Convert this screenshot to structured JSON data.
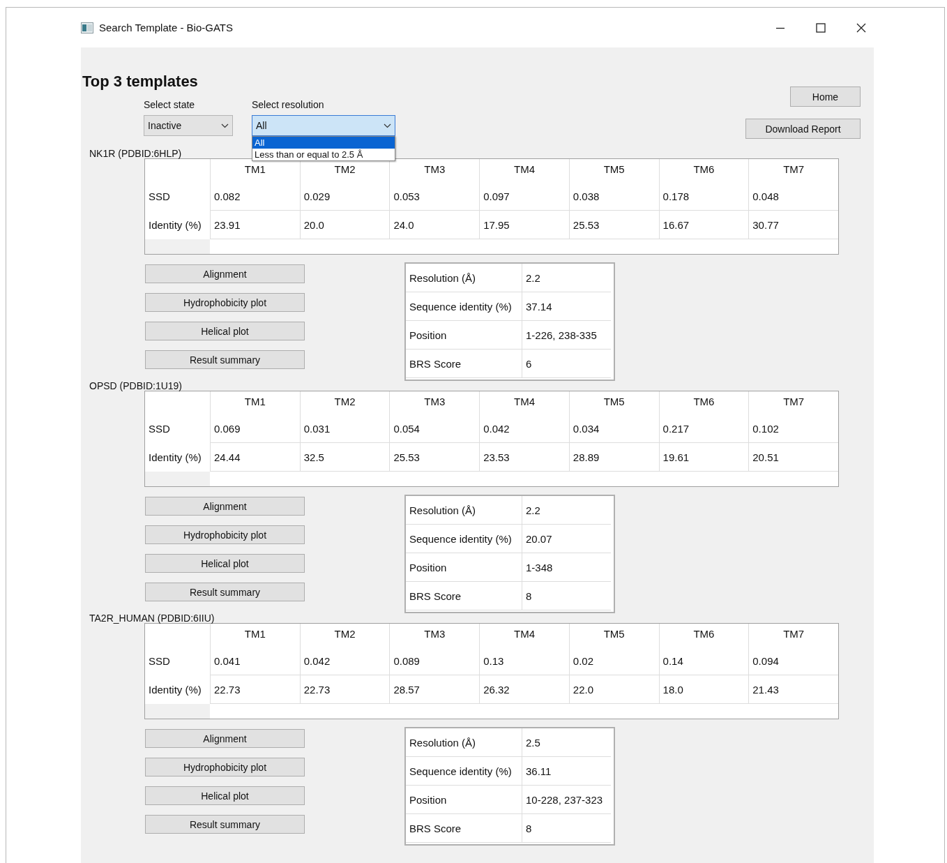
{
  "window": {
    "title": "Search Template - Bio-GATS"
  },
  "heading": "Top 3 templates",
  "state_select": {
    "label": "Select state",
    "value": "Inactive"
  },
  "resolution_select": {
    "label": "Select resolution",
    "value": "All",
    "expanded": true,
    "options": [
      {
        "label": "All",
        "selected": true
      },
      {
        "label": "Less than or equal to 2.5 Å",
        "selected": false
      }
    ]
  },
  "buttons": [
    "Home",
    "Download Report"
  ],
  "templates": [
    {
      "name": "NK1R (PDBID:6HLP)",
      "columns": [
        "TM1",
        "TM2",
        "TM3",
        "TM4",
        "TM5",
        "TM6",
        "TM7"
      ],
      "rows": [
        {
          "label": "SSD",
          "values": [
            "0.082",
            "0.029",
            "0.053",
            "0.097",
            "0.038",
            "0.178",
            "0.048"
          ]
        },
        {
          "label": "Identity (%)",
          "values": [
            "23.91",
            "20.0",
            "24.0",
            "17.95",
            "25.53",
            "16.67",
            "30.77"
          ]
        }
      ],
      "actions": [
        "Alignment",
        "Hydrophobicity plot",
        "Helical plot",
        "Result summary"
      ],
      "details": [
        {
          "label": "Resolution (Å)",
          "value": "2.2"
        },
        {
          "label": "Sequence identity (%)",
          "value": "37.14"
        },
        {
          "label": "Position",
          "value": "1-226, 238-335"
        },
        {
          "label": "BRS Score",
          "value": "6"
        }
      ]
    },
    {
      "name": "OPSD (PDBID:1U19)",
      "columns": [
        "TM1",
        "TM2",
        "TM3",
        "TM4",
        "TM5",
        "TM6",
        "TM7"
      ],
      "rows": [
        {
          "label": "SSD",
          "values": [
            "0.069",
            "0.031",
            "0.054",
            "0.042",
            "0.034",
            "0.217",
            "0.102"
          ]
        },
        {
          "label": "Identity (%)",
          "values": [
            "24.44",
            "32.5",
            "25.53",
            "23.53",
            "28.89",
            "19.61",
            "20.51"
          ]
        }
      ],
      "actions": [
        "Alignment",
        "Hydrophobicity plot",
        "Helical plot",
        "Result summary"
      ],
      "details": [
        {
          "label": "Resolution (Å)",
          "value": "2.2"
        },
        {
          "label": "Sequence identity (%)",
          "value": "20.07"
        },
        {
          "label": "Position",
          "value": "1-348"
        },
        {
          "label": "BRS Score",
          "value": "8"
        }
      ]
    },
    {
      "name": "TA2R_HUMAN (PDBID:6IIU)",
      "columns": [
        "TM1",
        "TM2",
        "TM3",
        "TM4",
        "TM5",
        "TM6",
        "TM7"
      ],
      "rows": [
        {
          "label": "SSD",
          "values": [
            "0.041",
            "0.042",
            "0.089",
            "0.13",
            "0.02",
            "0.14",
            "0.094"
          ]
        },
        {
          "label": "Identity (%)",
          "values": [
            "22.73",
            "22.73",
            "28.57",
            "26.32",
            "22.0",
            "18.0",
            "21.43"
          ]
        }
      ],
      "actions": [
        "Alignment",
        "Hydrophobicity plot",
        "Helical plot",
        "Result summary"
      ],
      "details": [
        {
          "label": "Resolution (Å)",
          "value": "2.5"
        },
        {
          "label": "Sequence identity (%)",
          "value": "36.11"
        },
        {
          "label": "Position",
          "value": "10-228, 237-323"
        },
        {
          "label": "BRS Score",
          "value": "8"
        }
      ]
    }
  ]
}
